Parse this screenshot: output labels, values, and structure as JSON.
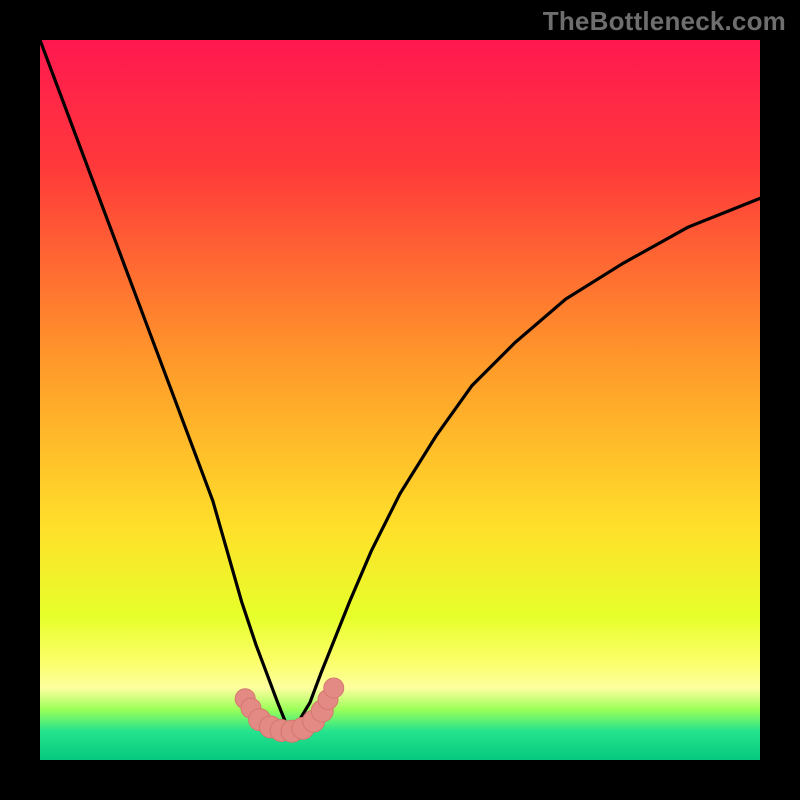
{
  "watermark": "TheBottleneck.com",
  "colors": {
    "bg_black": "#000000",
    "grad_top": "#ff1850",
    "grad_red": "#ff3a3a",
    "grad_orange": "#ff9a2a",
    "grad_yellow": "#ffe02a",
    "grad_ygreen": "#e6ff2a",
    "grad_lemon": "#fbff66",
    "grad_paleyellow": "#fdff9f",
    "grad_limeband": "#9bff59",
    "grad_teal": "#25e38e",
    "grad_bottom": "#06c97f",
    "curve_stroke": "#000000",
    "marker_fill": "#e38a84",
    "marker_stroke": "#d6766f"
  },
  "chart_data": {
    "type": "line",
    "title": "",
    "xlabel": "",
    "ylabel": "",
    "xlim": [
      0,
      100
    ],
    "ylim": [
      0,
      100
    ],
    "series": [
      {
        "name": "bottleneck-curve",
        "x": [
          0,
          3,
          6,
          9,
          12,
          15,
          18,
          21,
          24,
          26,
          28,
          30,
          31.5,
          33,
          34,
          35,
          36,
          37.5,
          39,
          41,
          43,
          46,
          50,
          55,
          60,
          66,
          73,
          81,
          90,
          100
        ],
        "y": [
          100,
          92,
          84,
          76,
          68,
          60,
          52,
          44,
          36,
          29,
          22,
          16,
          12,
          8,
          5.5,
          4,
          5.5,
          8,
          12,
          17,
          22,
          29,
          37,
          45,
          52,
          58,
          64,
          69,
          74,
          78
        ]
      }
    ],
    "markers_bottom": {
      "name": "optimal-region-markers",
      "points": [
        {
          "x": 28.5,
          "y": 8.5
        },
        {
          "x": 29.3,
          "y": 7.2
        },
        {
          "x": 30.5,
          "y": 5.6
        },
        {
          "x": 32.0,
          "y": 4.6
        },
        {
          "x": 33.5,
          "y": 4.1
        },
        {
          "x": 35.0,
          "y": 4.0
        },
        {
          "x": 36.5,
          "y": 4.4
        },
        {
          "x": 38.0,
          "y": 5.4
        },
        {
          "x": 39.2,
          "y": 6.8
        },
        {
          "x": 40.0,
          "y": 8.4
        },
        {
          "x": 40.8,
          "y": 10.0
        }
      ]
    },
    "gradient_stops_pct": [
      {
        "offset": 0,
        "key": "grad_top"
      },
      {
        "offset": 18,
        "key": "grad_red"
      },
      {
        "offset": 45,
        "key": "grad_orange"
      },
      {
        "offset": 68,
        "key": "grad_yellow"
      },
      {
        "offset": 80,
        "key": "grad_ygreen"
      },
      {
        "offset": 86,
        "key": "grad_lemon"
      },
      {
        "offset": 90,
        "key": "grad_paleyellow"
      },
      {
        "offset": 93,
        "key": "grad_limeband"
      },
      {
        "offset": 96,
        "key": "grad_teal"
      },
      {
        "offset": 100,
        "key": "grad_bottom"
      }
    ]
  }
}
